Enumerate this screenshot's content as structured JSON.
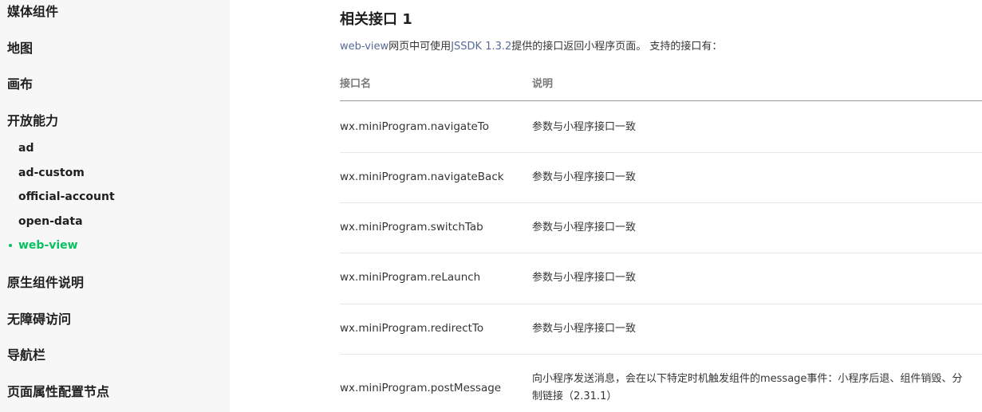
{
  "sidebar": {
    "items_top_1": [
      {
        "label": "媒体组件"
      },
      {
        "label": "地图"
      },
      {
        "label": "画布"
      },
      {
        "label": "开放能力"
      }
    ],
    "sub_items": [
      {
        "label": "ad"
      },
      {
        "label": "ad-custom"
      },
      {
        "label": "official-account"
      },
      {
        "label": "open-data"
      },
      {
        "label": "web-view",
        "active": true
      }
    ],
    "items_top_2": [
      {
        "label": "原生组件说明"
      },
      {
        "label": "无障碍访问"
      },
      {
        "label": "导航栏"
      },
      {
        "label": "页面属性配置节点"
      }
    ],
    "active_color": "#07c160"
  },
  "main": {
    "section_title": "相关接口 1",
    "intro": {
      "link1": "web-view",
      "text1": "网页中可使用",
      "link2": "JSSDK 1.3.2",
      "text2": "提供的接口返回小程序页面。 支持的接口有："
    },
    "table": {
      "headers": [
        "接口名",
        "说明"
      ],
      "rows": [
        {
          "name": "wx.miniProgram.navigateTo",
          "desc": "参数与小程序接口一致"
        },
        {
          "name": "wx.miniProgram.navigateBack",
          "desc": "参数与小程序接口一致"
        },
        {
          "name": "wx.miniProgram.switchTab",
          "desc": "参数与小程序接口一致"
        },
        {
          "name": "wx.miniProgram.reLaunch",
          "desc": "参数与小程序接口一致"
        },
        {
          "name": "wx.miniProgram.redirectTo",
          "desc": "参数与小程序接口一致"
        },
        {
          "name": "wx.miniProgram.postMessage",
          "desc_line1": "向小程序发送消息，会在以下特定时机触发组件的message事件：小程序后退、组件销毁、分",
          "desc_line2": "制链接（2.31.1）"
        }
      ]
    },
    "link_color": "#576b95"
  }
}
